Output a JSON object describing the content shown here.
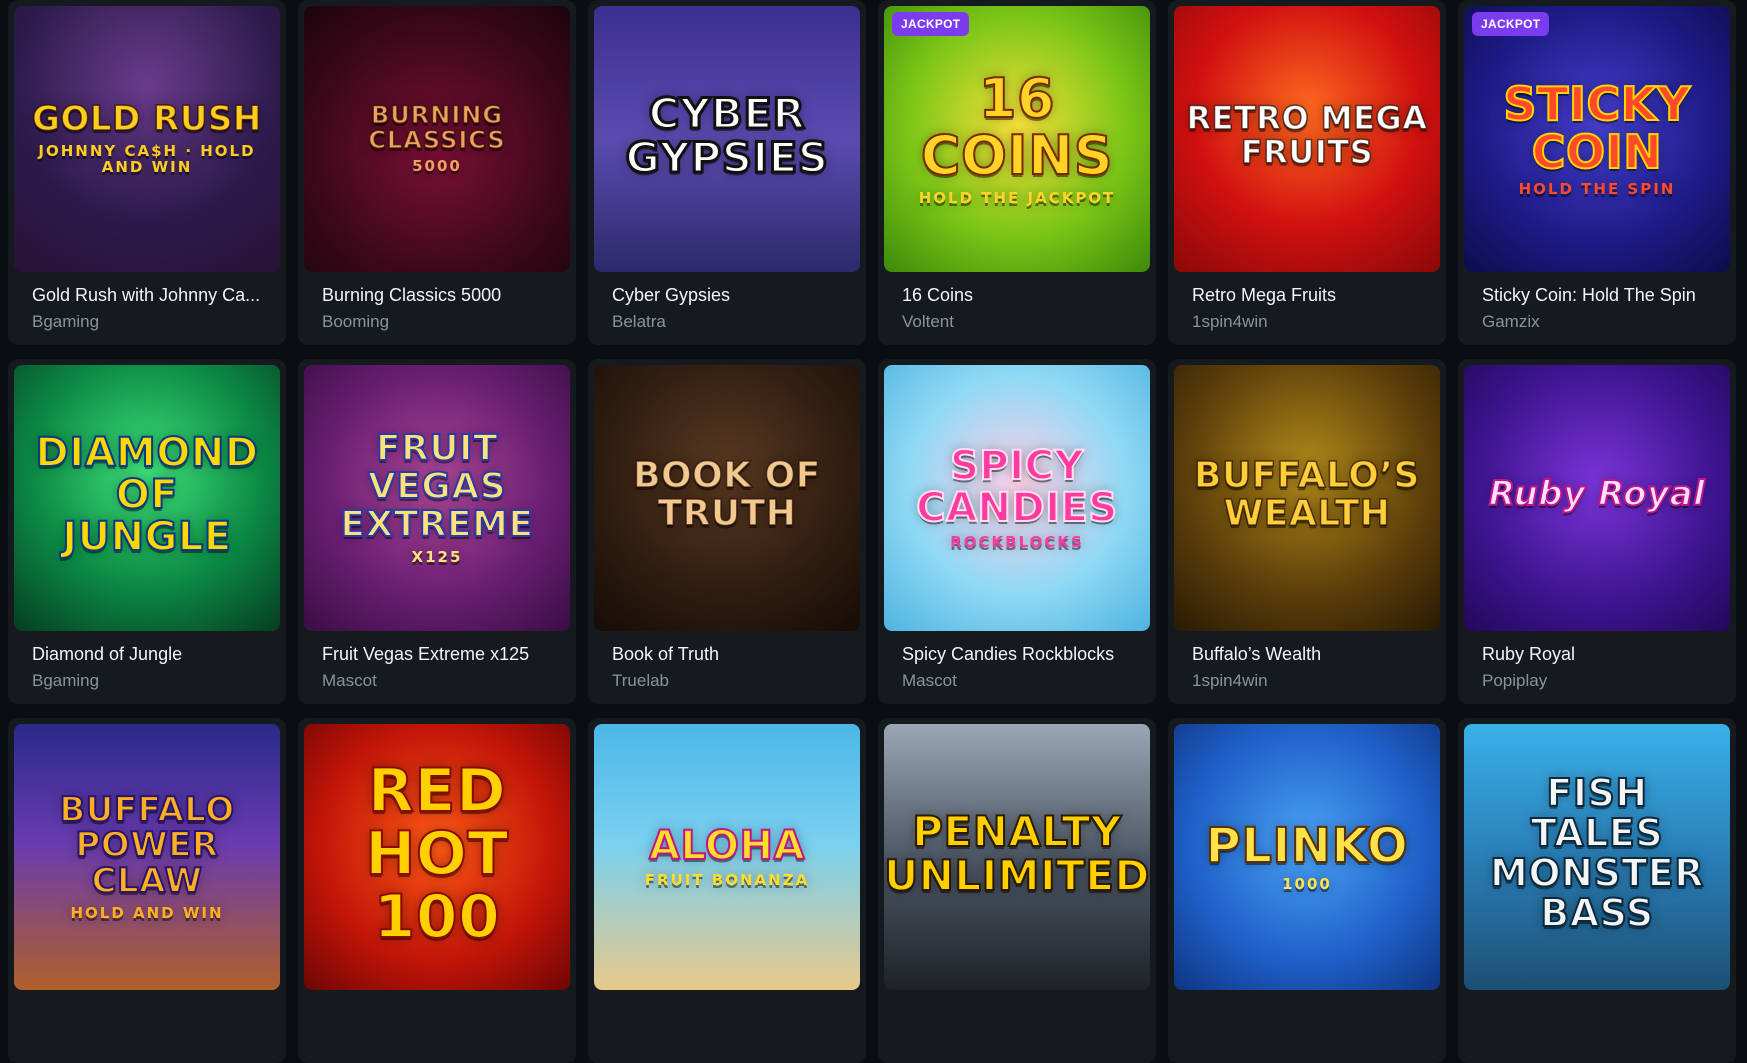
{
  "games": [
    {
      "title": "Gold Rush with Johnny Ca...",
      "provider": "Bgaming",
      "art": "GOLD RUSH",
      "art_sub": "JOHNNY CA$H · HOLD AND WIN",
      "badge": ""
    },
    {
      "title": "Burning Classics 5000",
      "provider": "Booming",
      "art": "BURNING CLASSICS",
      "art_sub": "5000",
      "badge": ""
    },
    {
      "title": "Cyber Gypsies",
      "provider": "Belatra",
      "art": "CYBER GYPSIES",
      "art_sub": "",
      "badge": ""
    },
    {
      "title": "16 Coins",
      "provider": "Voltent",
      "art": "16 COINS",
      "art_sub": "HOLD THE JACKPOT",
      "badge": "JACKPOT"
    },
    {
      "title": "Retro Mega Fruits",
      "provider": "1spin4win",
      "art": "RETRO MEGA FRUITS",
      "art_sub": "",
      "badge": ""
    },
    {
      "title": "Sticky Coin: Hold The Spin",
      "provider": "Gamzix",
      "art": "STICKY COIN",
      "art_sub": "HOLD THE SPIN",
      "badge": "JACKPOT"
    },
    {
      "title": "Diamond of Jungle",
      "provider": "Bgaming",
      "art": "DIAMOND OF JUNGLE",
      "art_sub": "",
      "badge": ""
    },
    {
      "title": "Fruit Vegas Extreme x125",
      "provider": "Mascot",
      "art": "FRUIT VEGAS EXTREME",
      "art_sub": "X125",
      "badge": ""
    },
    {
      "title": "Book of Truth",
      "provider": "Truelab",
      "art": "BOOK OF TRUTH",
      "art_sub": "",
      "badge": ""
    },
    {
      "title": "Spicy Candies Rockblocks",
      "provider": "Mascot",
      "art": "SPICY CANDIES",
      "art_sub": "ROCKBLOCKS",
      "badge": ""
    },
    {
      "title": "Buffalo’s Wealth",
      "provider": "1spin4win",
      "art": "BUFFALO’S WEALTH",
      "art_sub": "",
      "badge": ""
    },
    {
      "title": "Ruby Royal",
      "provider": "Popiplay",
      "art": "Ruby Royal",
      "art_sub": "",
      "badge": ""
    },
    {
      "title": "",
      "provider": "",
      "art": "BUFFALO POWER CLAW",
      "art_sub": "HOLD AND WIN",
      "badge": ""
    },
    {
      "title": "",
      "provider": "",
      "art": "RED HOT 100",
      "art_sub": "",
      "badge": ""
    },
    {
      "title": "",
      "provider": "",
      "art": "ALOHA",
      "art_sub": "FRUIT BONANZA",
      "badge": ""
    },
    {
      "title": "",
      "provider": "",
      "art": "PENALTY UNLIMITED",
      "art_sub": "",
      "badge": ""
    },
    {
      "title": "",
      "provider": "",
      "art": "PLINKO",
      "art_sub": "1000",
      "badge": ""
    },
    {
      "title": "",
      "provider": "",
      "art": "FISH TALES MONSTER BASS",
      "art_sub": "",
      "badge": ""
    }
  ],
  "colors": {
    "page_bg": "#0b0e10",
    "card_bg": "#151a1f",
    "badge_bg": "#7b3cf0",
    "provider_text": "#8a939c"
  }
}
